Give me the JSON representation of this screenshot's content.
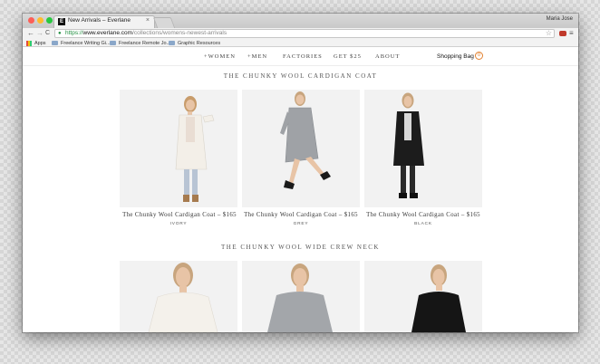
{
  "browser": {
    "tab": {
      "favicon": "E",
      "title": "New Arrivals – Everlane",
      "close": "×"
    },
    "profile_name": "Maria Jose",
    "nav": {
      "back": "←",
      "forward": "→",
      "reload": "C"
    },
    "url": {
      "scheme": "https://",
      "host": "www.everlane.com",
      "path": "/collections/womens-newest-arrivals"
    },
    "menu_icon": "≡",
    "star_icon": "☆",
    "bookmarks": [
      {
        "label": "Apps",
        "icon": "apps-grid-icon"
      },
      {
        "label": "Freelance Writing Gi...",
        "icon": "folder-icon"
      },
      {
        "label": "Freelance Remote Jo...",
        "icon": "folder-icon"
      },
      {
        "label": "Graphic Resources",
        "icon": "folder-icon"
      }
    ]
  },
  "site": {
    "nav": [
      "+WOMEN",
      "+MEN",
      "FACTORIES",
      "GET $25",
      "ABOUT"
    ],
    "shopping_bag_label": "Shopping Bag",
    "shopping_bag_count": "0"
  },
  "sections": [
    {
      "title": "THE CHUNKY WOOL CARDIGAN COAT",
      "products": [
        {
          "name": "The Chunky Wool Cardigan Coat – $165",
          "color": "IVORY",
          "garment_color": "#f3efe8"
        },
        {
          "name": "The Chunky Wool Cardigan Coat – $165",
          "color": "GREY",
          "garment_color": "#9fa2a6"
        },
        {
          "name": "The Chunky Wool Cardigan Coat – $165",
          "color": "BLACK",
          "garment_color": "#1c1c1c"
        }
      ]
    },
    {
      "title": "THE CHUNKY WOOL WIDE CREW NECK",
      "products": [
        {
          "garment_color": "#f4f1eb"
        },
        {
          "garment_color": "#a3a6aa"
        },
        {
          "garment_color": "#151515"
        }
      ]
    }
  ],
  "colors": {
    "accent": "#e2812f",
    "secure": "#1e8e3e"
  }
}
